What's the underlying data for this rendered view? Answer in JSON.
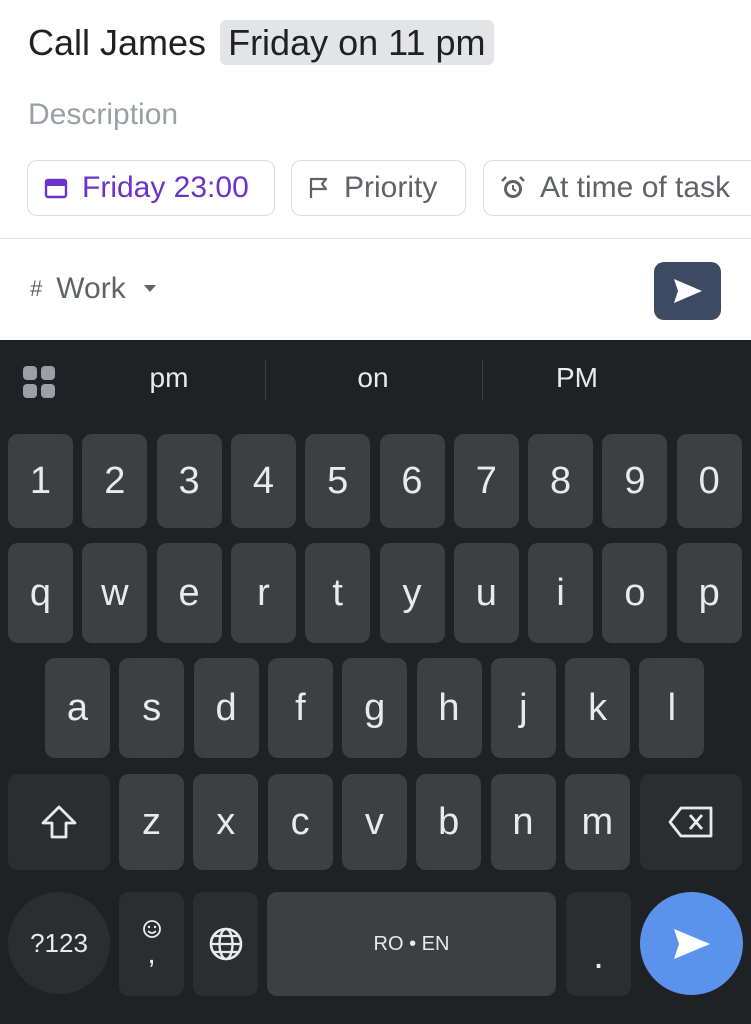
{
  "task": {
    "title_prefix": "Call James",
    "title_highlight": "Friday on 11 pm",
    "description_placeholder": "Description",
    "chips": {
      "date": "Friday 23:00",
      "priority": "Priority",
      "reminder": "At time of task"
    },
    "project": "Work",
    "project_hash": "#"
  },
  "keyboard": {
    "suggestions": [
      "pm",
      "on",
      "PM"
    ],
    "row_numbers": [
      "1",
      "2",
      "3",
      "4",
      "5",
      "6",
      "7",
      "8",
      "9",
      "0"
    ],
    "row_q": [
      "q",
      "w",
      "e",
      "r",
      "t",
      "y",
      "u",
      "i",
      "o",
      "p"
    ],
    "row_a": [
      "a",
      "s",
      "d",
      "f",
      "g",
      "h",
      "j",
      "k",
      "l"
    ],
    "row_z": [
      "z",
      "x",
      "c",
      "v",
      "b",
      "n",
      "m"
    ],
    "symbols_label": "?123",
    "comma_label": ",",
    "period_label": ".",
    "space_label": "RO • EN"
  },
  "colors": {
    "date_accent": "#6b34c9",
    "send_button": "#3d4a63",
    "keyboard_bg": "#202124",
    "key_bg": "#3c4043",
    "enter_key": "#5b93ec"
  }
}
